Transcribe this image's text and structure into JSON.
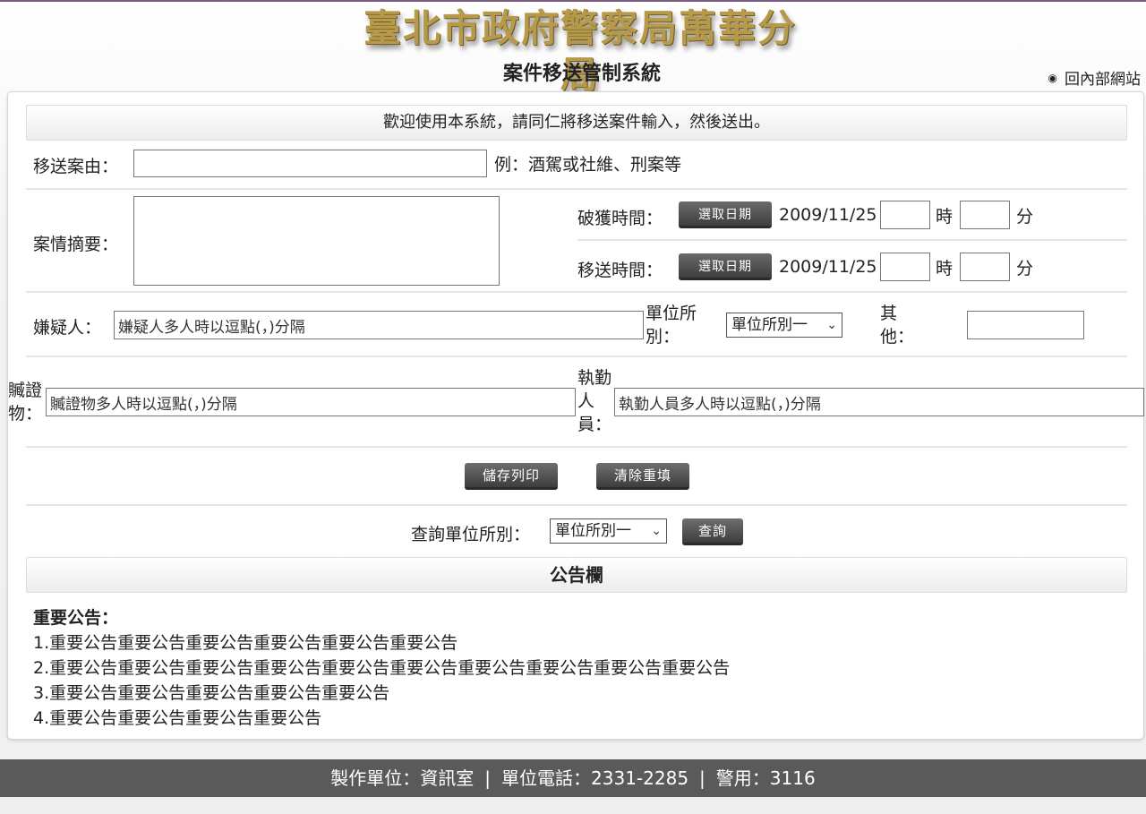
{
  "header": {
    "logo_text": "臺北市政府警察局萬華分局",
    "subtitle": "案件移送管制系統",
    "back_link": "回內部網站"
  },
  "welcome": "歡迎使用本系統，請同仁將移送案件輸入，然後送出。",
  "form": {
    "case_reason_label": "移送案由：",
    "case_reason_value": "",
    "case_reason_hint": "例：酒駕或社維、刑案等",
    "summary_label": "案情摘要：",
    "summary_value": "",
    "solved_time_label": "破獲時間：",
    "transfer_time_label": "移送時間：",
    "pick_date_button": "選取日期",
    "solved_date": "2009/11/25",
    "transfer_date": "2009/11/25",
    "hour_label": "時",
    "minute_label": "分",
    "suspect_label": "嫌疑人：",
    "suspect_placeholder": "嫌疑人多人時以逗點(，)分隔",
    "unit_label": "單位所別：",
    "unit_selected": "單位所別一",
    "other_label": "其他：",
    "other_value": "",
    "evidence_label": "贓證物：",
    "evidence_placeholder": "贓證物多人時以逗點(，)分隔",
    "duty_label": "執勤人員：",
    "duty_placeholder": "執勤人員多人時以逗點(，)分隔",
    "save_print_button": "儲存列印",
    "clear_button": "清除重填"
  },
  "query": {
    "label": "查詢單位所別：",
    "selected": "單位所別一",
    "button": "查詢"
  },
  "bulletin": {
    "title": "公告欄",
    "heading": "重要公告：",
    "items": [
      "1.重要公告重要公告重要公告重要公告重要公告重要公告",
      "2.重要公告重要公告重要公告重要公告重要公告重要公告重要公告重要公告重要公告重要公告",
      "3.重要公告重要公告重要公告重要公告重要公告",
      "4.重要公告重要公告重要公告重要公告"
    ]
  },
  "footer": {
    "producer": "製作單位：資訊室",
    "phone": "單位電話：2331-2285",
    "police_line": "警用：3116"
  }
}
